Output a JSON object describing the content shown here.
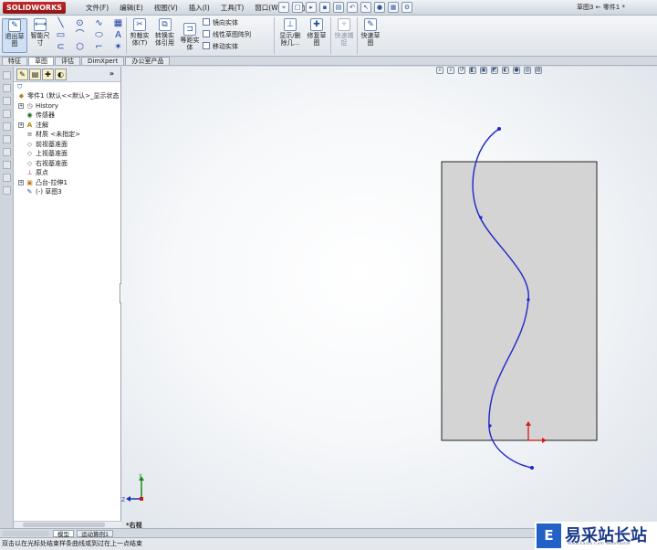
{
  "app": {
    "logo": "SOLIDWORKS",
    "document_title": "草图3 ← 零件1 *"
  },
  "menu": [
    {
      "label": "文件(F)"
    },
    {
      "label": "编辑(E)"
    },
    {
      "label": "视图(V)"
    },
    {
      "label": "插入(I)"
    },
    {
      "label": "工具(T)"
    },
    {
      "label": "窗口(W)"
    },
    {
      "label": "帮助(H)"
    }
  ],
  "ribbon": {
    "exit_sketch": "退出草图",
    "smart_dimension": "智能尺寸",
    "trim": "剪裁实体(T)",
    "convert": "转换实体引用",
    "offset": "等距实体",
    "mirror": "镜向实体",
    "linear_pattern": "线性草图阵列",
    "move": "移动实体",
    "display_delete": "显示/删除几...",
    "repair": "修复草图",
    "quick_snap": "快速捕捉",
    "rapid_sketch": "快速草图"
  },
  "tabs": [
    {
      "label": "特征"
    },
    {
      "label": "草图"
    },
    {
      "label": "评估"
    },
    {
      "label": "DimXpert"
    },
    {
      "label": "办公室产品"
    }
  ],
  "tree": {
    "filter_icon": "funnel-icon",
    "root": "零件1  (默认<<默认>_显示状态",
    "items": [
      {
        "label": "History",
        "icon": "history-icon"
      },
      {
        "label": "传感器",
        "icon": "sensor-icon"
      },
      {
        "label": "注解",
        "icon": "annotation-icon"
      },
      {
        "label": "材质 <未指定>",
        "icon": "material-icon"
      },
      {
        "label": "前视基准面",
        "icon": "plane-icon"
      },
      {
        "label": "上视基准面",
        "icon": "plane-icon"
      },
      {
        "label": "右视基准面",
        "icon": "plane-icon"
      },
      {
        "label": "原点",
        "icon": "origin-icon"
      },
      {
        "label": "凸台-拉伸1",
        "icon": "extrude-icon"
      },
      {
        "label": "(-) 草图3",
        "icon": "sketch-icon"
      }
    ]
  },
  "viewport": {
    "view_name": "*右视",
    "triad_labels": {
      "y": "Y",
      "z": "Z"
    },
    "rect_fill": "#d4d4d4",
    "curve_color": "#1f25c9",
    "origin_color": "#d11a1a"
  },
  "bottom_tabs": [
    {
      "label": "模型"
    },
    {
      "label": "运动算例1"
    }
  ],
  "status": {
    "text": "双击以在光标处结束样条曲线或到过在上一点结束"
  },
  "watermark": {
    "logo_char": "E",
    "title": "易采站长站",
    "subtitle": "Www.Easck.Com Webmaster"
  }
}
